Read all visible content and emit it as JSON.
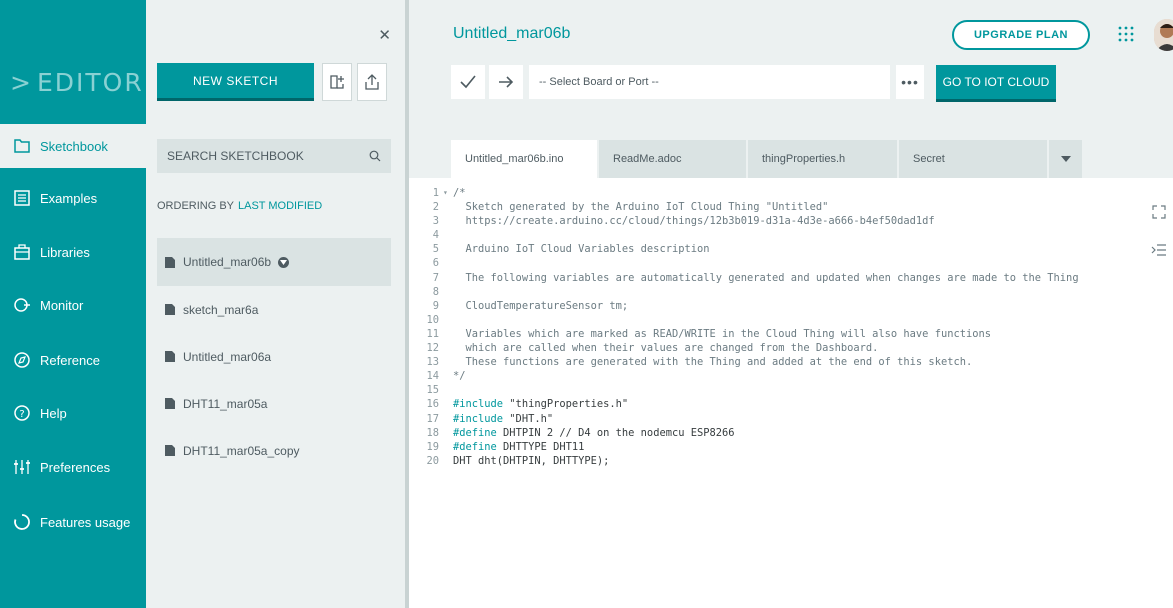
{
  "nav": {
    "brand": "EDITOR",
    "items": [
      {
        "label": "Sketchbook",
        "icon": "folder-icon"
      },
      {
        "label": "Examples",
        "icon": "list-icon"
      },
      {
        "label": "Libraries",
        "icon": "library-icon"
      },
      {
        "label": "Monitor",
        "icon": "monitor-icon"
      },
      {
        "label": "Reference",
        "icon": "compass-icon"
      },
      {
        "label": "Help",
        "icon": "help-icon"
      },
      {
        "label": "Preferences",
        "icon": "sliders-icon"
      },
      {
        "label": "Features usage",
        "icon": "usage-icon"
      }
    ]
  },
  "sketchbook": {
    "new_sketch": "NEW SKETCH",
    "search_placeholder": "SEARCH SKETCHBOOK",
    "ordering_label": "ORDERING BY",
    "ordering_value": "LAST MODIFIED",
    "sketches": [
      "Untitled_mar06b",
      "sketch_mar6a",
      "Untitled_mar06a",
      "DHT11_mar05a",
      "DHT11_mar05a_copy"
    ]
  },
  "main": {
    "title": "Untitled_mar06b",
    "upgrade": "UPGRADE PLAN",
    "board_select": "-- Select Board or Port --",
    "more": "•••",
    "iot_button": "GO TO IOT CLOUD",
    "tabs": [
      "Untitled_mar06b.ino",
      "ReadMe.adoc",
      "thingProperties.h",
      "Secret"
    ]
  },
  "code": {
    "lines": [
      "/*",
      "  Sketch generated by the Arduino IoT Cloud Thing \"Untitled\"",
      "  https://create.arduino.cc/cloud/things/12b3b019-d31a-4d3e-a666-b4ef50dad1df",
      "",
      "  Arduino IoT Cloud Variables description",
      "",
      "  The following variables are automatically generated and updated when changes are made to the Thing",
      "",
      "  CloudTemperatureSensor tm;",
      "",
      "  Variables which are marked as READ/WRITE in the Cloud Thing will also have functions",
      "  which are called when their values are changed from the Dashboard.",
      "  These functions are generated with the Thing and added at the end of this sketch.",
      "*/",
      "",
      "#include \"thingProperties.h\"",
      "#include \"DHT.h\"",
      "#define DHTPIN 2 // D4 on the nodemcu ESP8266",
      "#define DHTTYPE DHT11",
      "DHT dht(DHTPIN, DHTTYPE);"
    ]
  },
  "colors": {
    "accent": "#00979d",
    "nav_bg": "#00979d",
    "panel_bg": "#ecf1f1"
  }
}
